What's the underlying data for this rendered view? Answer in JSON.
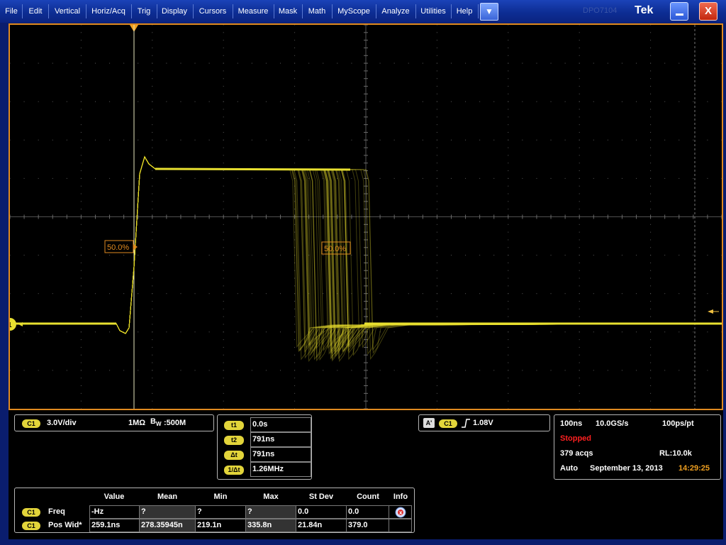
{
  "menu": {
    "items": [
      "File",
      "Edit",
      "Vertical",
      "Horiz/Acq",
      "Trig",
      "Display",
      "Cursors",
      "Measure",
      "Mask",
      "Math",
      "MyScope",
      "Analyze",
      "Utilities",
      "Help"
    ],
    "dropdown_icon": "▼",
    "model": "DPO7104",
    "brand": "Tek",
    "close_label": "X"
  },
  "screen": {
    "channel_marker": "1",
    "ref_left": "50.0%",
    "ref_right": "50.0%"
  },
  "channel": {
    "badge": "C1",
    "scale": "3.0V/div",
    "impedance": "1MΩ",
    "bw_label": "B",
    "bw_sub": "W",
    "bandwidth": ":500M"
  },
  "cursors": [
    {
      "label": "t1",
      "value": "0.0s"
    },
    {
      "label": "t2",
      "value": "791ns"
    },
    {
      "label": "Δt",
      "value": "791ns"
    },
    {
      "label": "1/Δt",
      "value": "1.26MHz"
    }
  ],
  "trigger": {
    "mode_badge": "A'",
    "channel": "C1",
    "slope_icon": "rising-edge",
    "level": "1.08V"
  },
  "acquisition": {
    "timebase": "100ns",
    "sample_rate": "10.0GS/s",
    "resolution": "100ps/pt",
    "status": "Stopped",
    "acqs": "379 acqs",
    "record_length": "RL:10.0k",
    "mode": "Auto",
    "date": "September 13, 2013",
    "time": "14:29:25"
  },
  "measurements": {
    "headers": [
      "Value",
      "Mean",
      "Min",
      "Max",
      "St Dev",
      "Count",
      "Info"
    ],
    "rows": [
      {
        "badge": "C1",
        "name": "Freq",
        "cells": [
          "-Hz",
          "?",
          "?",
          "?",
          "0.0",
          "0.0"
        ]
      },
      {
        "badge": "C1",
        "name": "Pos Wid*",
        "cells": [
          "259.1ns",
          "278.35945n",
          "219.1n",
          "335.8n",
          "21.84n",
          "379.0"
        ]
      }
    ]
  },
  "colors": {
    "trace": "#e8e030",
    "graticule": "#5a5a5a",
    "frame": "#e08a20",
    "menubar": "#0d2d94"
  }
}
